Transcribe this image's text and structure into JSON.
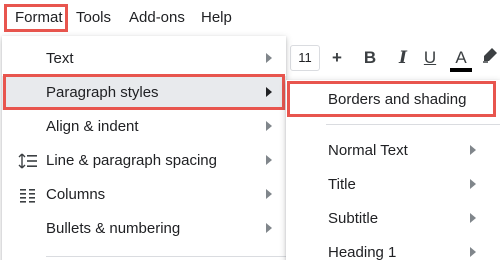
{
  "menubar": {
    "items": [
      "Format",
      "Tools",
      "Add-ons",
      "Help"
    ]
  },
  "toolbar": {
    "font_size": "11",
    "plus": "+",
    "bold": "B",
    "italic": "I",
    "underline": "U",
    "text_color": "A",
    "text_color_value": "#000000"
  },
  "format_menu": {
    "items": [
      {
        "label": "Text",
        "icon": null
      },
      {
        "label": "Paragraph styles",
        "icon": null
      },
      {
        "label": "Align & indent",
        "icon": null
      },
      {
        "label": "Line & paragraph spacing",
        "icon": "line-spacing-icon"
      },
      {
        "label": "Columns",
        "icon": "columns-icon"
      },
      {
        "label": "Bullets & numbering",
        "icon": null
      }
    ]
  },
  "paragraph_styles_menu": {
    "items": [
      {
        "label": "Borders and shading"
      },
      {
        "label": "Normal Text"
      },
      {
        "label": "Title"
      },
      {
        "label": "Subtitle"
      },
      {
        "label": "Heading 1"
      }
    ]
  },
  "colors": {
    "highlight_outline": "#e8554e",
    "hover_background": "#e8eaed"
  }
}
